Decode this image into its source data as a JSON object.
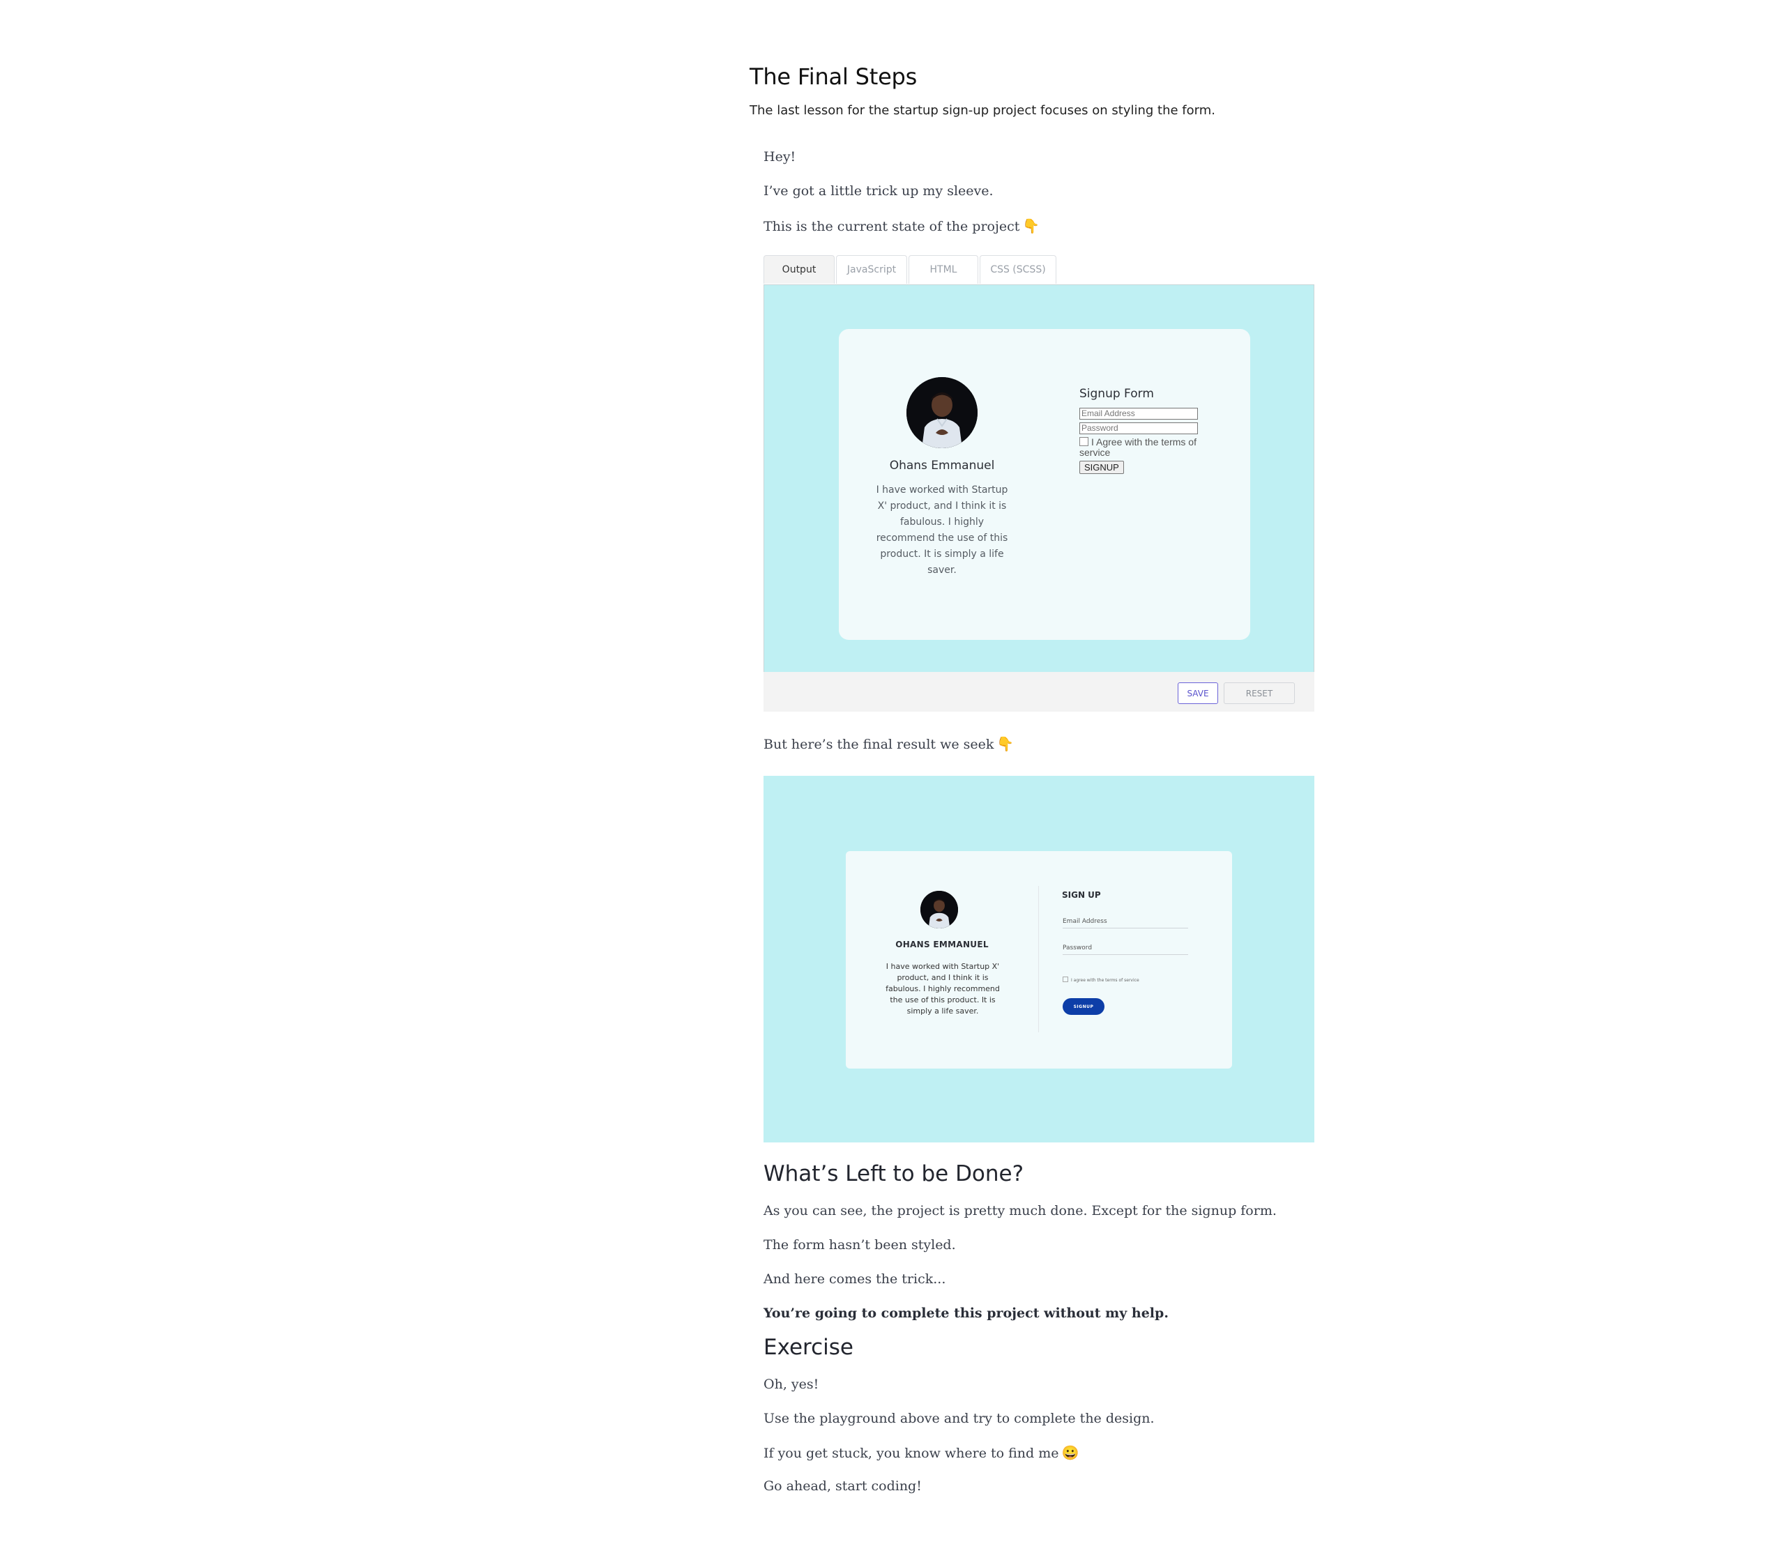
{
  "lesson": {
    "title": "The Final Steps",
    "description": "The last lesson for the startup sign-up project focuses on styling the form."
  },
  "article": {
    "p1": "Hey!",
    "p2": "I’ve got a little trick up my sleeve.",
    "p3": "This is the current state of the project",
    "p4": "But here’s the final result we seek",
    "h_left": "What’s Left to be Done?",
    "p5": "As you can see, the project is pretty much done. Except for the signup form.",
    "p6": "The form hasn’t been styled.",
    "p7": "And here comes the trick...",
    "p8": "You’re going to complete this project without my help.",
    "h_exercise": "Exercise",
    "p9": "Oh, yes!",
    "p10": "Use the playground above and try to complete the design.",
    "p11": "If you get stuck, you know where to find me",
    "p12": "Go ahead, start coding!",
    "emoji_point_down": "👇",
    "emoji_smile": "😀"
  },
  "playground": {
    "tabs": [
      "Output",
      "JavaScript",
      "HTML",
      "CSS (SCSS)"
    ],
    "active_tab": "Output",
    "save_label": "SAVE",
    "reset_label": "RESET",
    "output": {
      "name": "Ohans Emmanuel",
      "quote": "I have worked with Startup X' product, and I think it is fabulous. I highly recommend the use of this product. It is simply a life saver.",
      "form_title": "Signup Form",
      "email_placeholder": "Email Address",
      "password_placeholder": "Password",
      "agree_label": "I Agree with the terms of service",
      "signup_button": "SIGNUP"
    }
  },
  "final_result": {
    "name": "OHANS EMMANUEL",
    "quote": "I have worked with Startup X' product, and I think it is fabulous. I highly recommend the use of this product. It is simply a life saver.",
    "form_title": "SIGN UP",
    "email_label": "Email Address",
    "password_label": "Password",
    "agree_label": "I agree with the terms of service",
    "signup_button": "SIGNUP"
  },
  "colors": {
    "output_bg": "#bff0f3",
    "card_bg": "#f1fafb",
    "save_accent": "#5a52cc",
    "signup_button": "#0d3ea8"
  }
}
